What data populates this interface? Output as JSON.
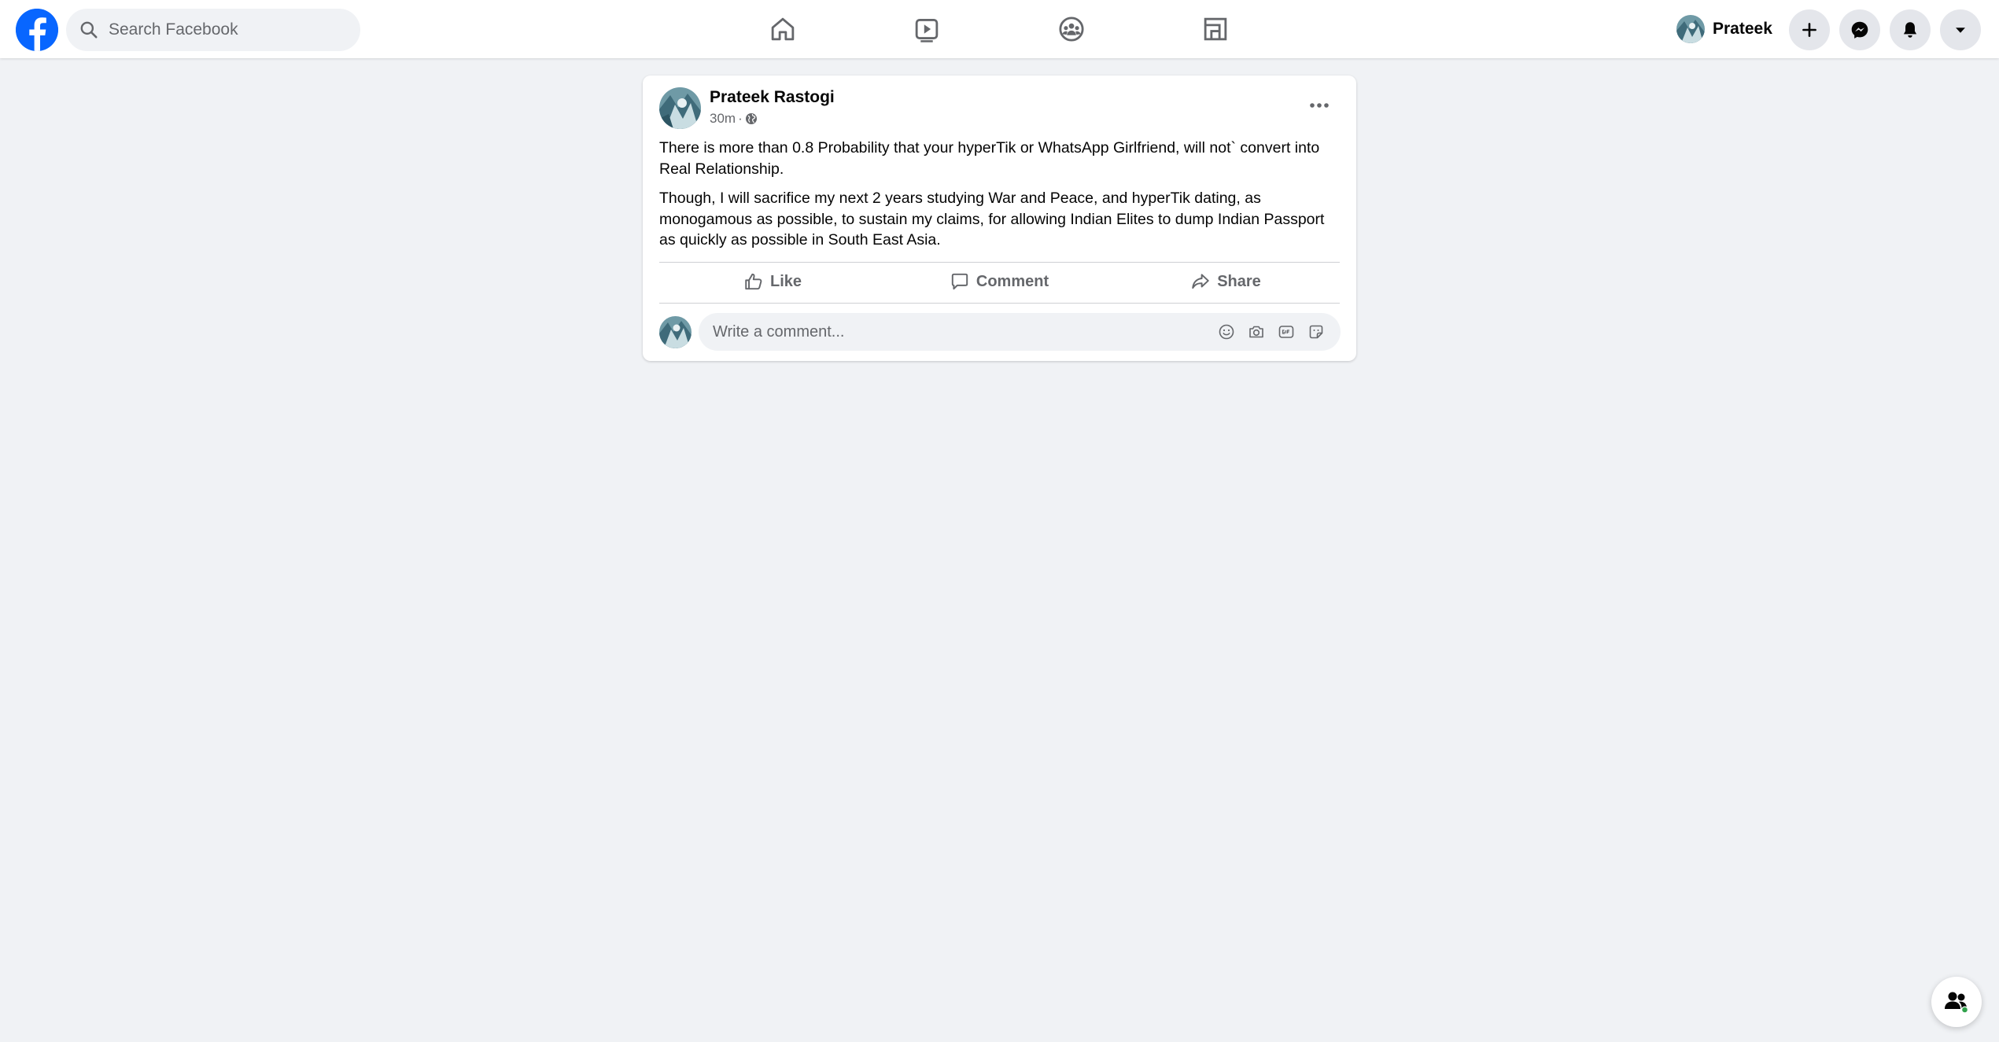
{
  "header": {
    "logo_icon": "facebook-logo-icon",
    "brand_color": "#0866ff",
    "search": {
      "placeholder": "Search Facebook",
      "value": "",
      "icon": "search-icon"
    },
    "nav_tabs": [
      {
        "id": "home",
        "icon": "home-icon"
      },
      {
        "id": "watch",
        "icon": "video-play-icon"
      },
      {
        "id": "groups",
        "icon": "groups-icon"
      },
      {
        "id": "gaming",
        "icon": "gaming-icon"
      }
    ],
    "profile_name": "Prateek",
    "buttons": [
      {
        "id": "create",
        "icon": "plus-icon"
      },
      {
        "id": "messenger",
        "icon": "messenger-icon"
      },
      {
        "id": "notifications",
        "icon": "bell-icon"
      },
      {
        "id": "account",
        "icon": "caret-down-icon"
      }
    ]
  },
  "post": {
    "author": "Prateek Rastogi",
    "time": "30m",
    "separator": "·",
    "audience_icon": "globe-icon",
    "menu_icon": "more-horizontal-icon",
    "paragraphs": [
      "There is more than 0.8 Probability that your hyperTik or WhatsApp Girlfriend, will not` convert into Real Relationship.",
      "Though, I will sacrifice my next 2 years studying War and Peace, and hyperTik dating, as monogamous as possible, to sustain my claims, for allowing Indian Elites to dump Indian Passport as quickly as possible in South East Asia."
    ],
    "actions": {
      "like": "Like",
      "comment": "Comment",
      "share": "Share"
    },
    "comment_input": {
      "placeholder": "Write a comment...",
      "value": "",
      "tools": [
        "emoji-icon",
        "camera-icon",
        "gif-icon",
        "sticker-icon"
      ]
    }
  },
  "contacts_fab": {
    "icon": "contacts-icon",
    "online_color": "#31a24c"
  },
  "colors": {
    "page_background": "#f0f2f5",
    "secondary_text": "#65676b"
  }
}
